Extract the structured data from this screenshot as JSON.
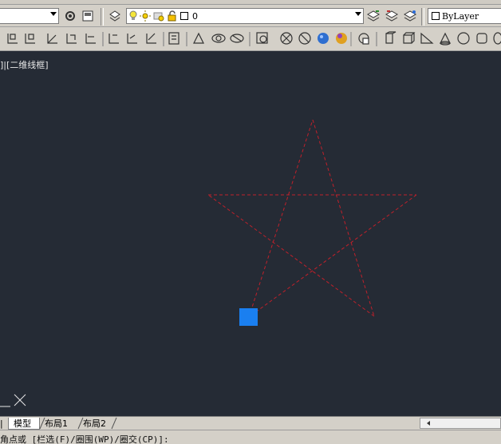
{
  "toolbar_row1": {
    "workspace_combo_value": "",
    "layer_combo_value": "0",
    "color_combo_value": "ByLayer"
  },
  "viewport": {
    "label": "]|[二维线框]"
  },
  "tabs": {
    "partial": "|",
    "model": "模型",
    "layout1": "布局1",
    "layout2": "布局2"
  },
  "command_line": {
    "text": "角点或 [栏选(F)/圈围(WP)/圈交(CP)]:"
  },
  "colors": {
    "canvas_bg": "#252b35",
    "star_line": "#c0202a",
    "grip": "#1a7ff0"
  },
  "icons": {
    "row1": [
      "gear-icon",
      "workspace-icon",
      "layer-manager-icon",
      "bulb-icon",
      "sun-icon",
      "lock-icon",
      "color-square-icon",
      "layer-state-icon",
      "layer-previous-icon",
      "match-layer-icon"
    ],
    "row2": [
      "ucs-icons",
      "view-3d-icons",
      "visual-style-icons",
      "solid-primitive-icons"
    ]
  }
}
